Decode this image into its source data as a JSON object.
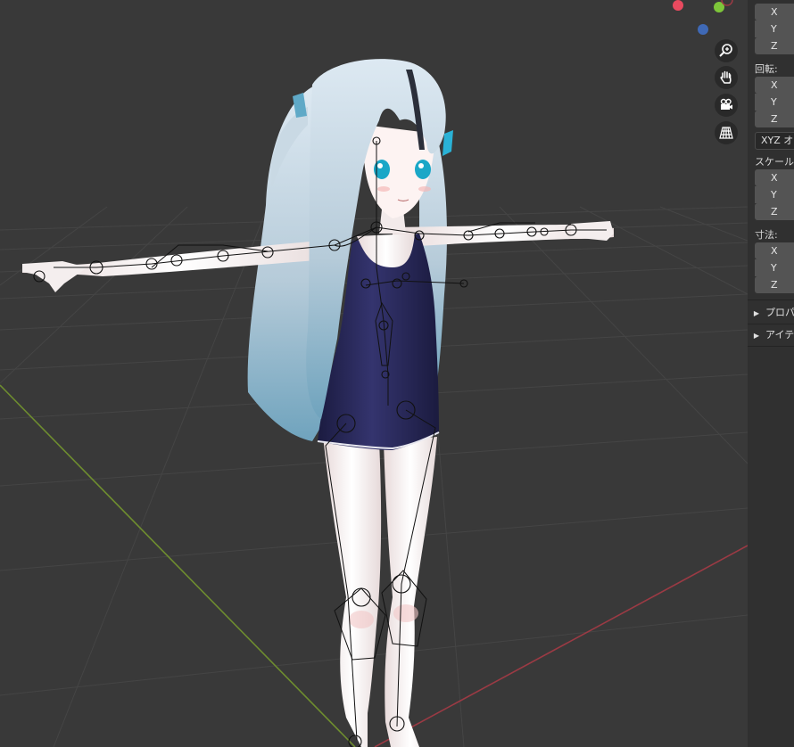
{
  "sidebar": {
    "location_axes": [
      "X",
      "Y",
      "Z"
    ],
    "rotation_label": "回転:",
    "rotation_axes": [
      "X",
      "Y",
      "Z"
    ],
    "rotation_mode": "XYZ オ",
    "scale_label": "スケール",
    "scale_axes": [
      "X",
      "Y",
      "Z"
    ],
    "dimensions_label": "寸法:",
    "dimensions_axes": [
      "X",
      "Y",
      "Z"
    ],
    "panels": [
      "プロパ",
      "アイテ"
    ]
  },
  "viewport": {
    "nav_icons": [
      "zoom-icon",
      "hand-pan-icon",
      "camera-icon",
      "perspective-grid-icon"
    ],
    "gizmo_colors": {
      "x": "#e84a5f",
      "y": "#7ec63a",
      "z": "#3f69b6"
    },
    "axis_colors": {
      "x_axis_line": "#9b3a44",
      "y_axis_line": "#6e8d2f"
    },
    "background": "#393939"
  }
}
